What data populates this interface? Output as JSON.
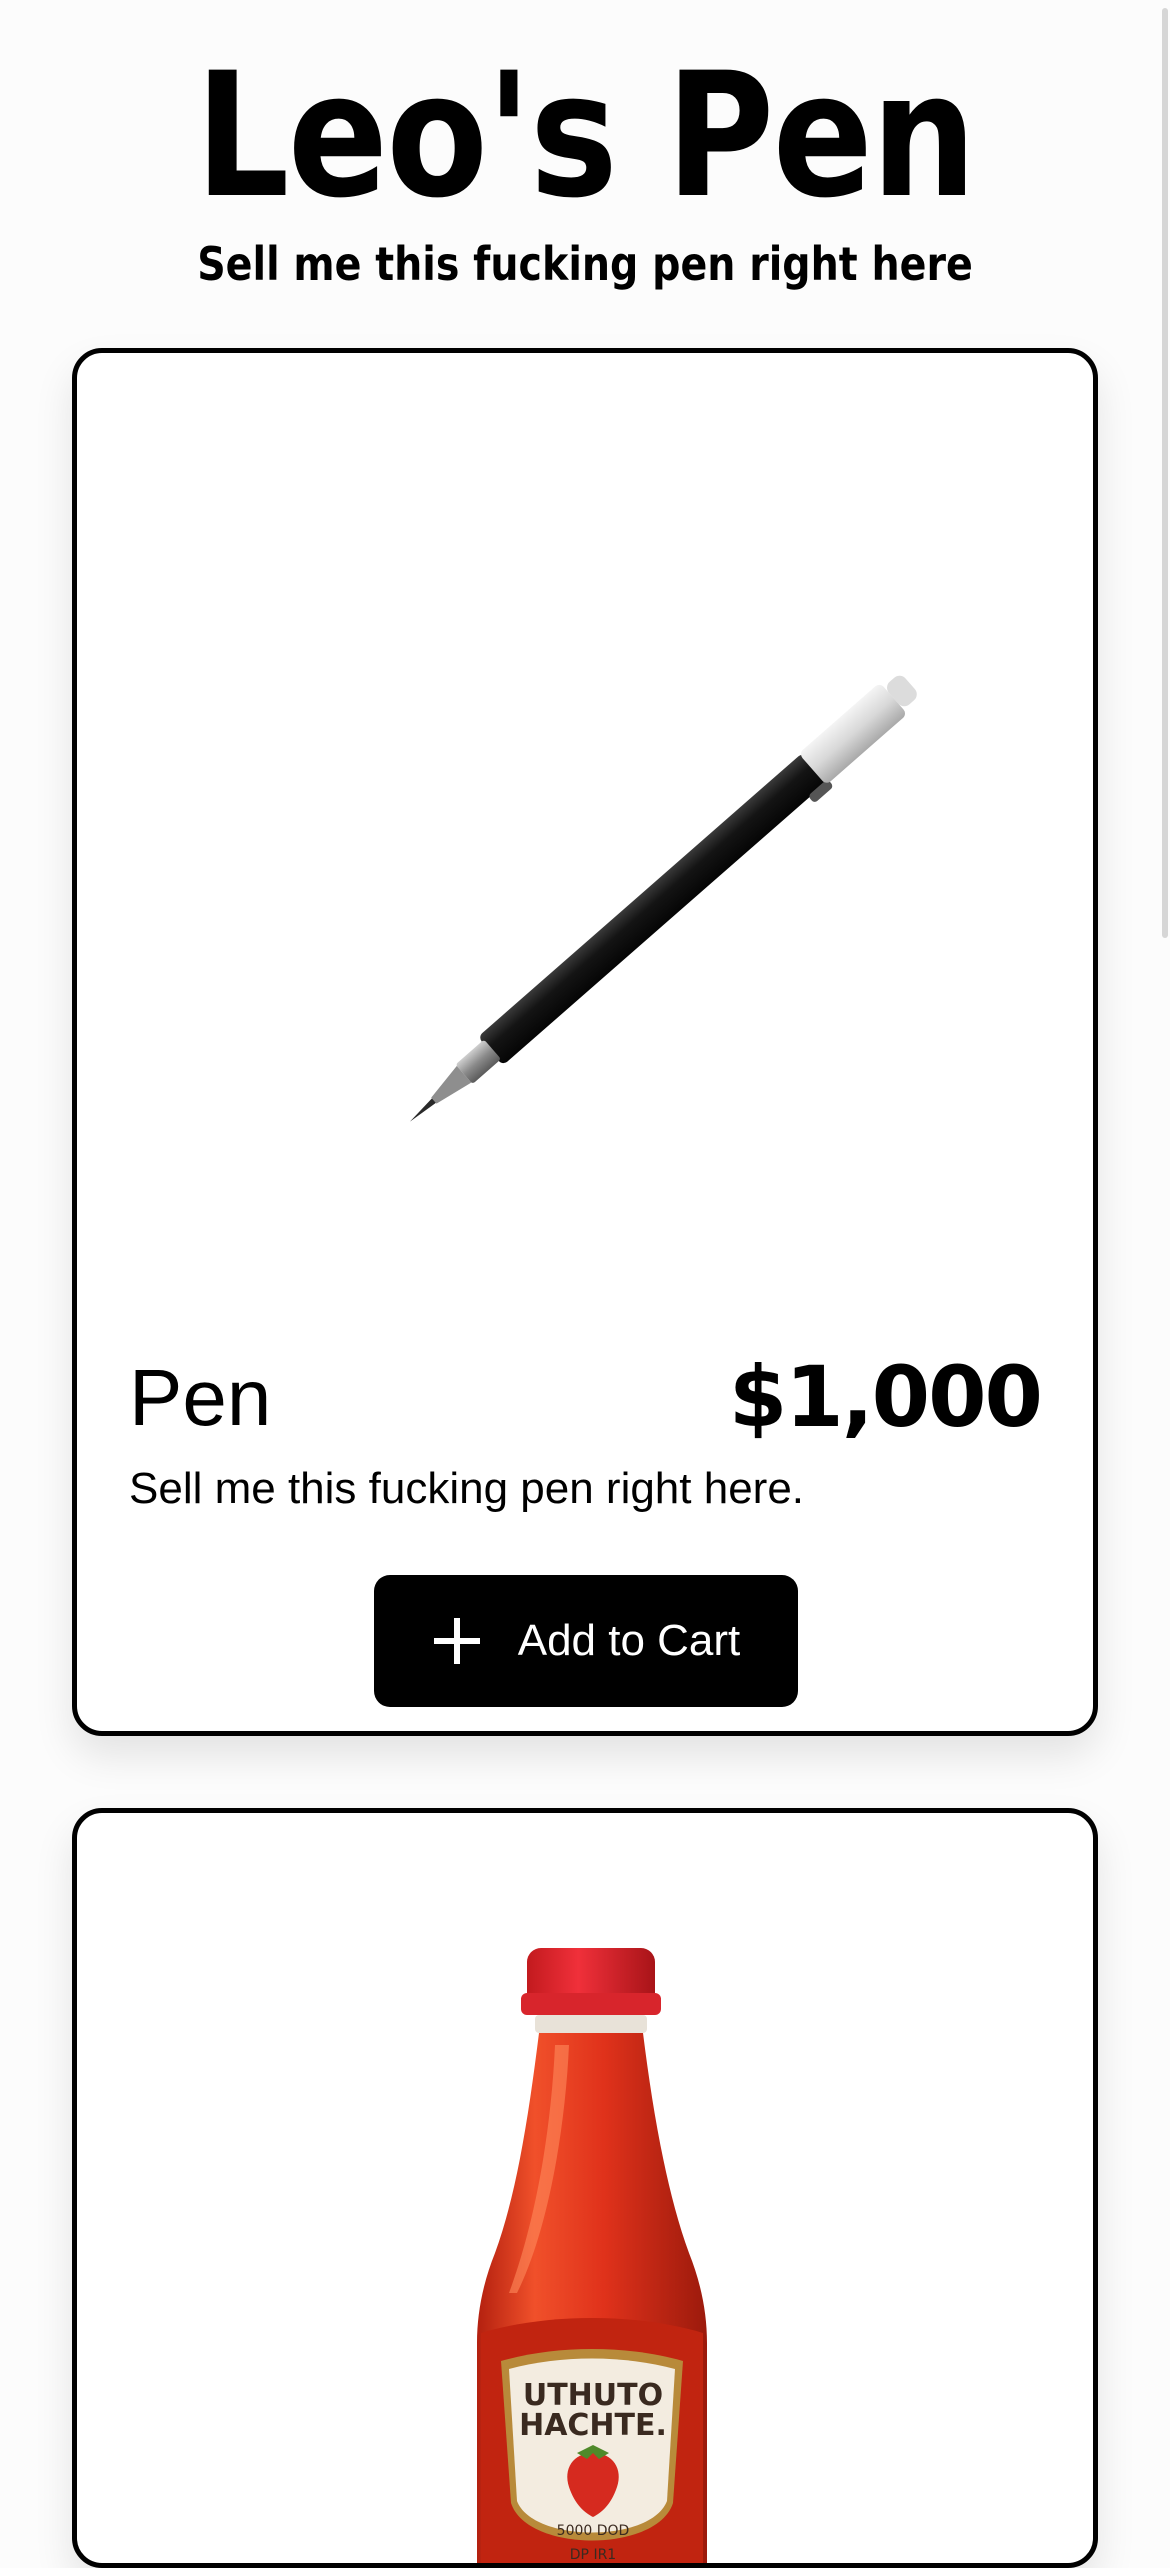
{
  "header": {
    "title": "Leo's Pen",
    "tagline": "Sell me this fucking pen right here"
  },
  "products": [
    {
      "name": "Pen",
      "price": "$1,000",
      "description": "Sell me this fucking pen right here.",
      "button_label": "Add to Cart",
      "button_icon": "plus-icon"
    },
    {
      "label_line1": "UTHUTO",
      "label_line2": "HACHTE.",
      "label_line3": "5000 DOD",
      "label_line4": "DP IR1"
    }
  ],
  "colors": {
    "background": "#fcfcfc",
    "card": "#ffffff",
    "border": "#000000",
    "button": "#000000",
    "button_text": "#ffffff",
    "sauce_red": "#e0321b"
  }
}
